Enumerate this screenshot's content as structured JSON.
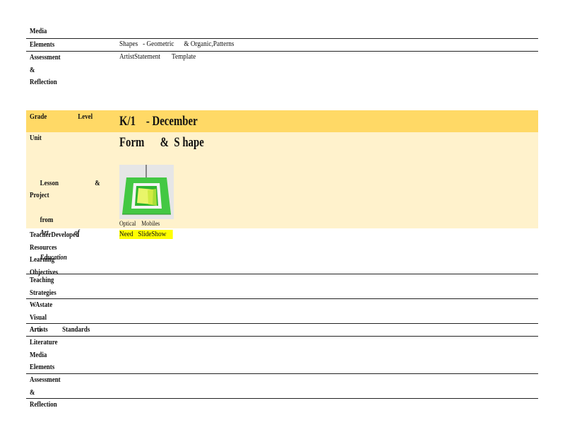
{
  "top_section": {
    "media_label": "Media",
    "elements_label": "Elements",
    "elements_value": "Shapes   - Geometric      & Organic,Patterns",
    "assessment_label": "Assessment          &\nReflection",
    "assessment_value": "ArtistStatement       Template"
  },
  "lesson": {
    "grade_label": "Grade      Level",
    "grade_value": "K/1    - December",
    "unit_label": "Unit",
    "unit_value": "Form      &  S hape",
    "lesson_label_1": "Lesson       & Project",
    "lesson_label_2": "from",
    "lesson_label_3": "Art     of",
    "lesson_label_4": "Education",
    "image_caption": "Optical    Mobiles",
    "image_alt": "optical mobile craft",
    "teacher_label": "TeacherDeveloped\nResources",
    "teacher_value": "Need   SlideShow",
    "objectives_label": "Learning       Objectives",
    "strategies_label": "Teaching        Strategies",
    "standards_label": "WAstate        Visual\nArts    Standards",
    "artists_label": "Artists",
    "literature_label": "Literature\nMedia\nElements",
    "assessment_label": "Assessment          &\nReflection"
  },
  "colors": {
    "band_dark": "#ffd966",
    "band_light": "#fff2cc",
    "highlight": "#ffff00"
  }
}
